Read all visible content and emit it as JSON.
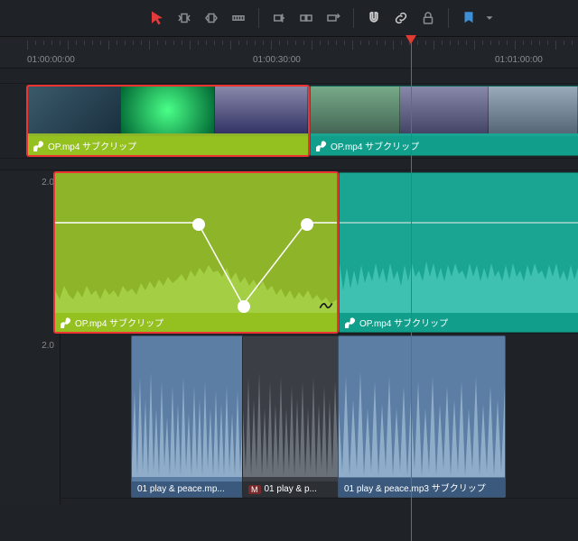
{
  "ruler": {
    "tc1": "01:00:00:00",
    "tc2": "01:00:30:00",
    "tc3": "01:01:00:00"
  },
  "track2": {
    "label": "2.0"
  },
  "track3": {
    "label": "2.0"
  },
  "clips": {
    "v1a": {
      "label": "OP.mp4 サブクリップ"
    },
    "v1b": {
      "label": "OP.mp4 サブクリップ"
    },
    "a1a": {
      "label": "OP.mp4 サブクリップ"
    },
    "a1b": {
      "label": "OP.mp4 サブクリップ"
    },
    "a2a": {
      "label": "01 play & peace.mp..."
    },
    "a2b": {
      "label": "01 play & p..."
    },
    "a2c": {
      "label": "01 play & peace.mp3 サブクリップ"
    }
  },
  "marker_badge": "M"
}
